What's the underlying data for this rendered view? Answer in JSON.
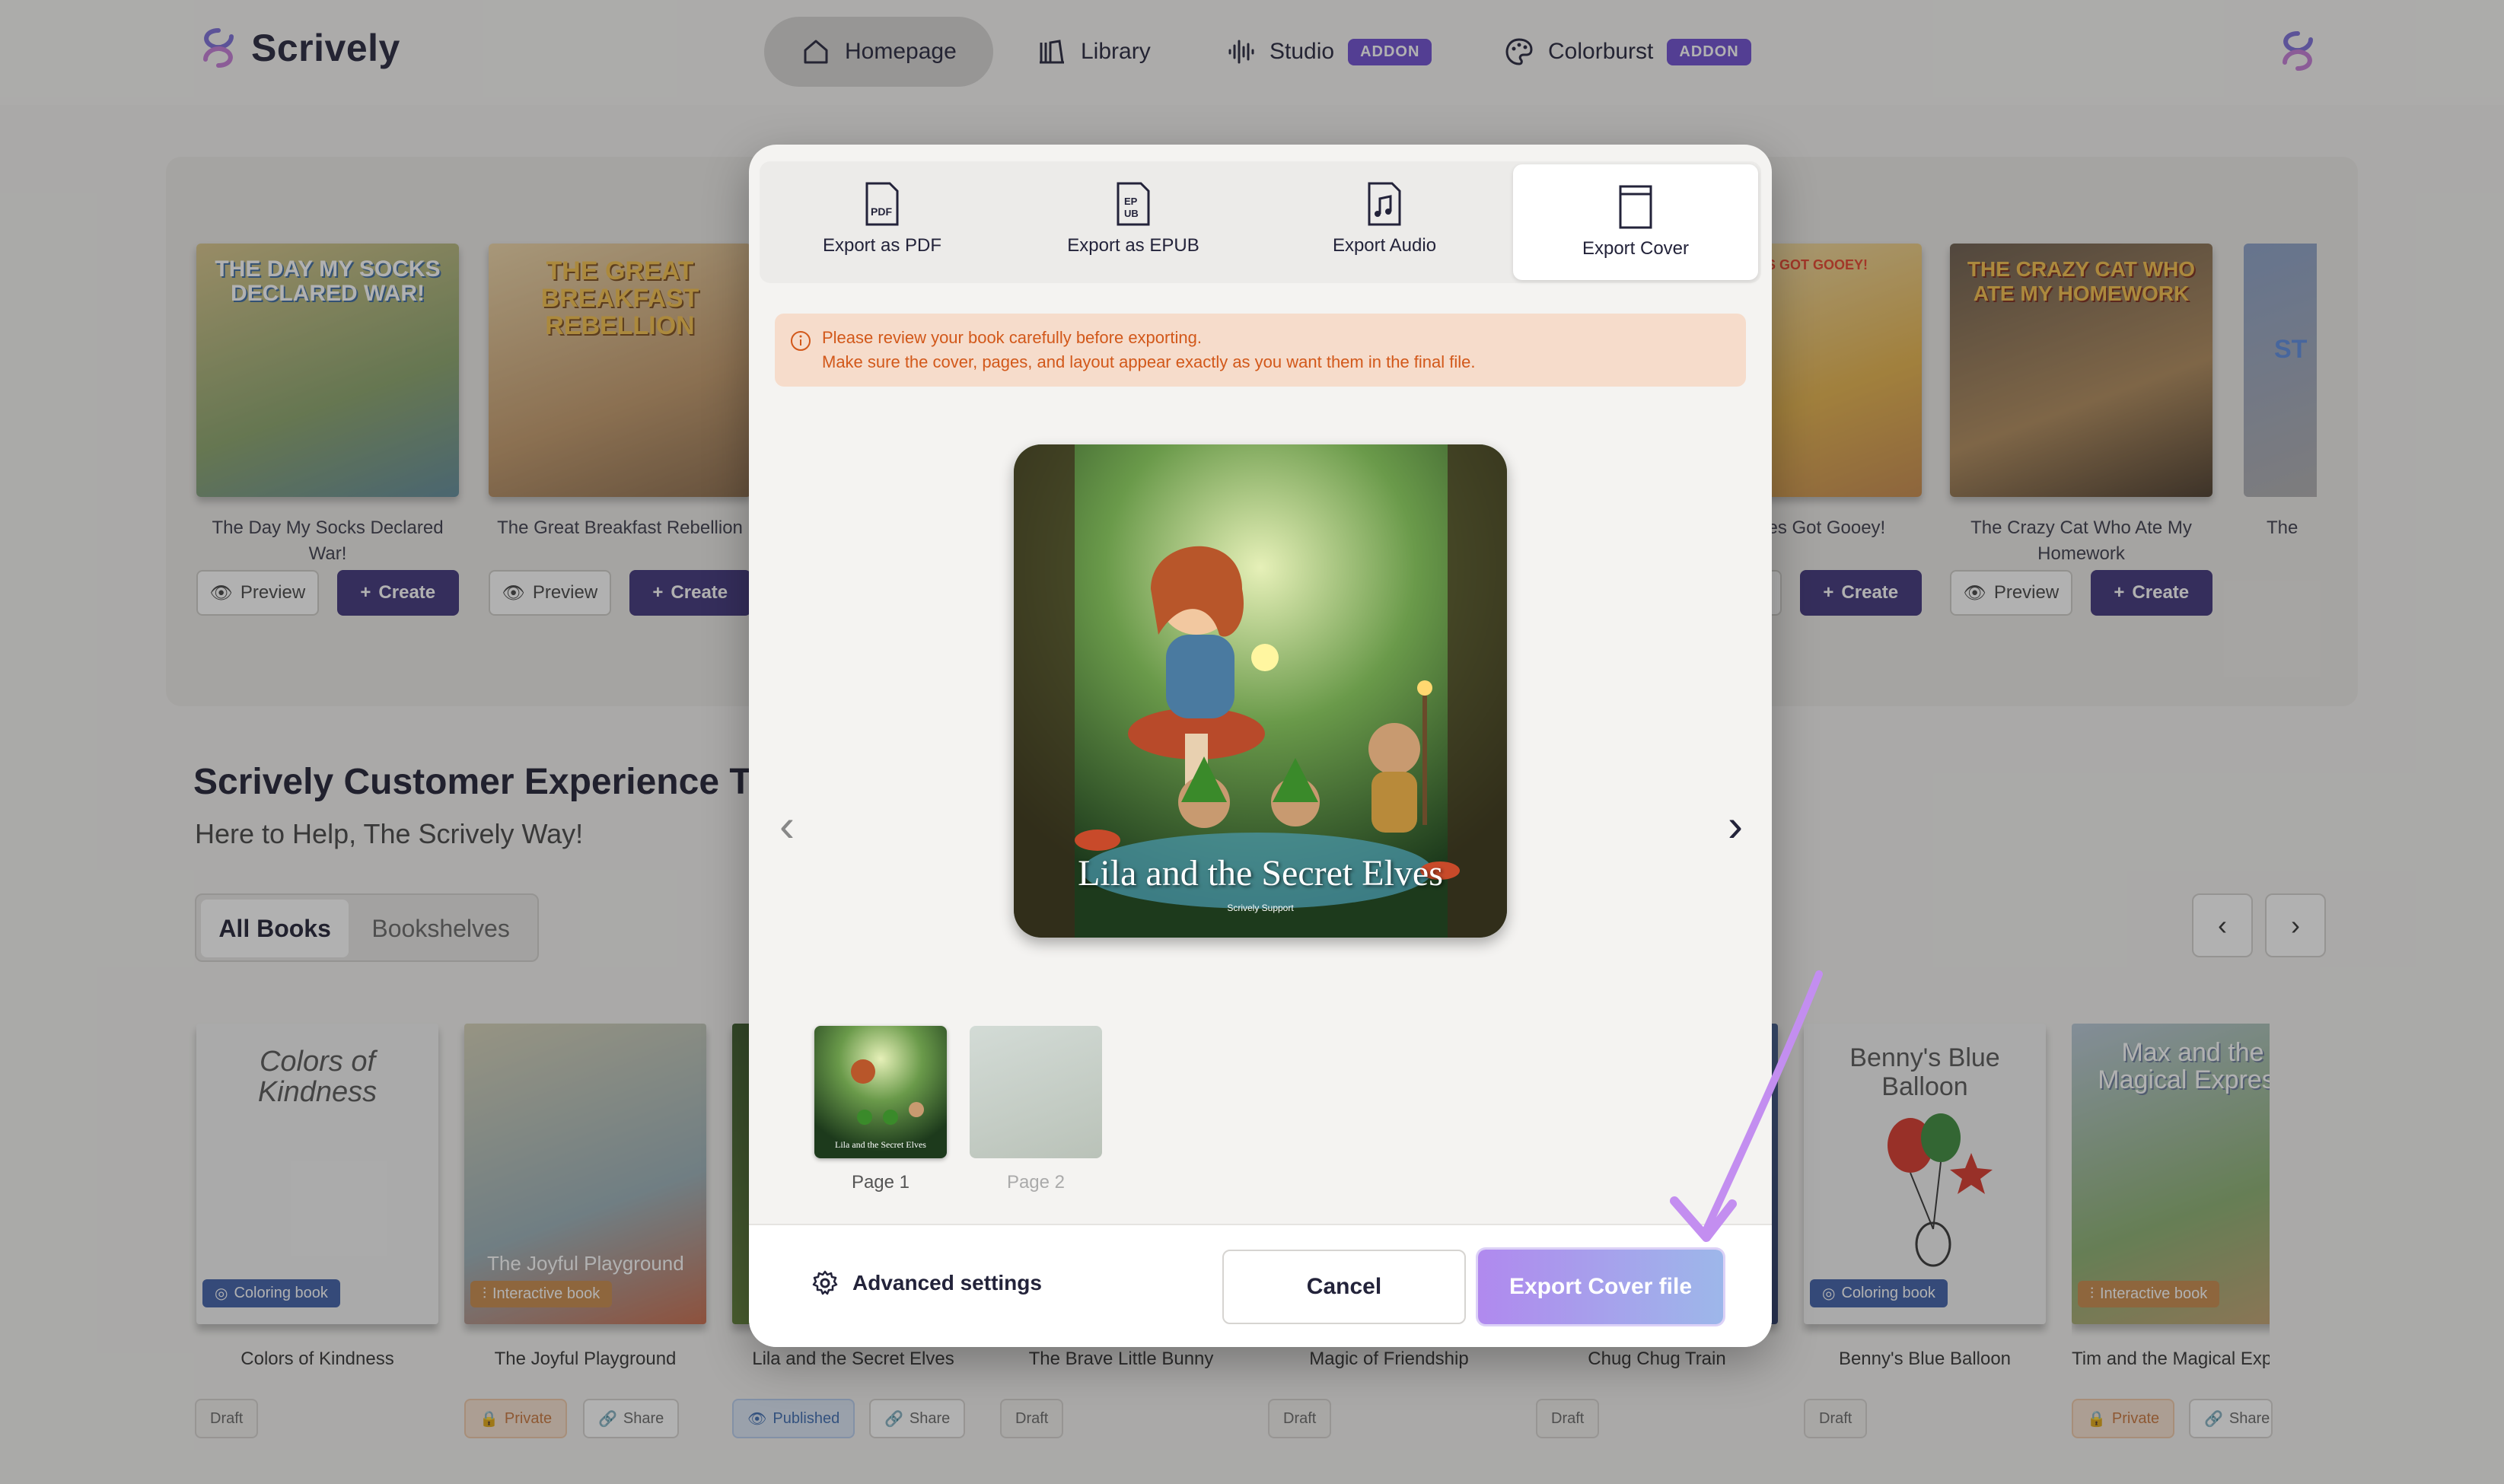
{
  "nav": {
    "brand": "Scrively",
    "items": [
      {
        "label": "Homepage",
        "active": true,
        "icon": "home-icon"
      },
      {
        "label": "Library",
        "icon": "library-icon"
      },
      {
        "label": "Studio",
        "badge": "ADDON",
        "icon": "audio-wave-icon"
      },
      {
        "label": "Colorburst",
        "badge": "ADDON",
        "icon": "palette-icon"
      }
    ]
  },
  "shelf": {
    "preview_label": "Preview",
    "create_label": "Create",
    "books": [
      {
        "title": "The Day My Socks Declared War!",
        "cover_text": "THE DAY MY SOCKS DECLARED WAR!"
      },
      {
        "title": "The Great Breakfast Rebellion",
        "cover_text": "THE GREAT BREAKFAST REBELLION"
      },
      {
        "title": "My Giggles Got Gooey!",
        "title_visible": "My Giggles Got Gooey!",
        "cover_text": "GIGGLES GOT GOOEY!"
      },
      {
        "title": "The Crazy Cat Who Ate My Homework",
        "cover_text": "THE CRAZY CAT WHO ATE MY HOMEWORK"
      },
      {
        "title": "The",
        "cover_text": "ST"
      }
    ]
  },
  "section": {
    "title": "Scrively Customer Experience Team",
    "subtitle": "Here to Help, The Scrively Way!",
    "seg_all": "All Books",
    "seg_shelves": "Bookshelves"
  },
  "grid": {
    "books": [
      {
        "title": "Colors of Kindness",
        "tag": "Coloring book",
        "cover_text": "Colors of Kindness",
        "status": "Draft"
      },
      {
        "title": "The Joyful Playground",
        "tag": "Interactive book",
        "cover_text": "The Joyful Playground",
        "status": "Private",
        "share": "Share"
      },
      {
        "title": "Lila and the Secret Elves",
        "status": "Published",
        "share": "Share"
      },
      {
        "title": "The Brave Little Bunny",
        "status": "Draft"
      },
      {
        "title": "Magic of Friendship",
        "status": "Draft"
      },
      {
        "title": "Chug Chug Train",
        "status": "Draft"
      },
      {
        "title": "Benny's Blue Balloon",
        "tag": "Coloring book",
        "cover_text": "Benny's Blue Balloon",
        "status": "Draft"
      },
      {
        "title": "Tim and the Magical Express",
        "tag": "Interactive book",
        "cover_text": "Max and the Magical Express",
        "status": "Private",
        "share": "Share"
      }
    ]
  },
  "modal": {
    "tabs": [
      {
        "label": "Export as PDF",
        "icon": "pdf-file-icon"
      },
      {
        "label": "Export as EPUB",
        "icon": "epub-file-icon"
      },
      {
        "label": "Export Audio",
        "icon": "audio-file-icon"
      },
      {
        "label": "Export Cover",
        "icon": "cover-file-icon",
        "active": true
      }
    ],
    "warning_line1": "Please review your book carefully before exporting.",
    "warning_line2": "Make sure the cover, pages, and layout appear exactly as you want them in the final file.",
    "cover_title": "Lila and the Secret Elves",
    "cover_author": "Scrively Support",
    "thumbs": [
      {
        "label": "Page 1"
      },
      {
        "label": "Page 2"
      }
    ],
    "advanced_label": "Advanced settings",
    "cancel_label": "Cancel",
    "export_label": "Export Cover file"
  },
  "colors": {
    "primary": "#3e327a",
    "addon": "#6c4bd1",
    "warning_bg": "#f6dccb",
    "warning_text": "#d2581a",
    "annotation_arrow": "#c38ef0"
  }
}
